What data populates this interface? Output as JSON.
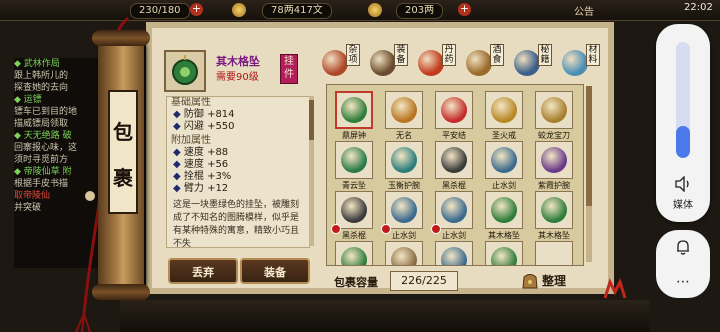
{
  "topbar": {
    "stamina": "230/180",
    "silver": "78两417文",
    "gold": "203两",
    "announce": "公告",
    "time": "22:02"
  },
  "quests": [
    {
      "t": "◆ 武林作局",
      "c": "h"
    },
    {
      "t": "跟上韩所儿的",
      "c": ""
    },
    {
      "t": "探查她的去向",
      "c": ""
    },
    {
      "t": "◆ 运镖",
      "c": "h"
    },
    {
      "t": "镖车已到目的地",
      "c": ""
    },
    {
      "t": "描威镖局领取",
      "c": ""
    },
    {
      "t": "◆ 天无绝路 破",
      "c": "h"
    },
    {
      "t": "回寨报心味，这",
      "c": ""
    },
    {
      "t": "须时寻觅前方",
      "c": ""
    },
    {
      "t": "◆ 帝陵仙草 附",
      "c": "h"
    },
    {
      "t": "根据手皮书描",
      "c": ""
    },
    {
      "t": "取帝陵仙",
      "c": "r"
    },
    {
      "t": "并突破",
      "c": ""
    }
  ],
  "scroll": {
    "label_top": "包",
    "label_bottom": "裹"
  },
  "item": {
    "name": "其木格坠",
    "requirement": "需要90级",
    "equip_label": "挂件",
    "base_title": "基础属性",
    "base_stats": [
      {
        "name": "防御",
        "value": "+814"
      },
      {
        "name": "闪避",
        "value": "+550"
      }
    ],
    "extra_title": "附加属性",
    "extra_stats": [
      {
        "name": "速度",
        "value": "+88"
      },
      {
        "name": "速度",
        "value": "+56"
      },
      {
        "name": "拴棍",
        "value": "+3%"
      },
      {
        "name": "臂力",
        "value": "+12"
      }
    ],
    "description": "这是一块墨绿色的挂坠，被雕刻成了不知名的图腾模样，似乎是有某种特殊的寓意，精致小巧且不失"
  },
  "buttons": {
    "discard": "丢弃",
    "equip": "装备",
    "sort": "整理"
  },
  "tabs": [
    {
      "label": "杂项",
      "color": "#b0472a"
    },
    {
      "label": "装备",
      "color": "#6a4c2e"
    },
    {
      "label": "丹药",
      "color": "#c23b1e"
    },
    {
      "label": "酒食",
      "color": "#9a6a2a"
    },
    {
      "label": "秘籍",
      "color": "#3b5f8a"
    },
    {
      "label": "材料",
      "color": "#4c8fb5"
    }
  ],
  "grid_items": [
    {
      "name": "鼎屏钟",
      "color": "#2f7d3a",
      "selected": true,
      "dot": false
    },
    {
      "name": "无名",
      "color": "#b8741f",
      "selected": false,
      "dot": false
    },
    {
      "name": "平安结",
      "color": "#c42b2b",
      "selected": false,
      "dot": false
    },
    {
      "name": "圣火戒",
      "color": "#b88726",
      "selected": false,
      "dot": false
    },
    {
      "name": "蛟龙宝刀",
      "color": "#a87f2e",
      "selected": false,
      "dot": false
    },
    {
      "name": "青云坠",
      "color": "#2b7a4a",
      "selected": false,
      "dot": false
    },
    {
      "name": "玉衡护腕",
      "color": "#2c7d7a",
      "selected": false,
      "dot": false
    },
    {
      "name": "黑杀棍",
      "color": "#3a3a3a",
      "selected": false,
      "dot": false
    },
    {
      "name": "止水剑",
      "color": "#3c6a8e",
      "selected": false,
      "dot": false
    },
    {
      "name": "紫霞护腕",
      "color": "#6a3a8a",
      "selected": false,
      "dot": false
    },
    {
      "name": "黑杀棍",
      "color": "#3a3a3a",
      "selected": false,
      "dot": true
    },
    {
      "name": "止水剑",
      "color": "#3c6a8e",
      "selected": false,
      "dot": true
    },
    {
      "name": "止水剑",
      "color": "#3c6a8e",
      "selected": false,
      "dot": true
    },
    {
      "name": "其木格坠",
      "color": "#2f7d3a",
      "selected": false,
      "dot": false
    },
    {
      "name": "其木格坠",
      "color": "#2f7d3a",
      "selected": false,
      "dot": false
    },
    {
      "name": "",
      "color": "#2f7d3a",
      "selected": false,
      "dot": true
    },
    {
      "name": "",
      "color": "#8a6b42",
      "selected": false,
      "dot": false
    },
    {
      "name": "",
      "color": "#3c6a8e",
      "selected": false,
      "dot": true
    },
    {
      "name": "",
      "color": "#2f7d3a",
      "selected": false,
      "dot": false
    },
    {
      "name": "",
      "color": "",
      "selected": false,
      "dot": false
    }
  ],
  "capacity": {
    "label": "包裹容量",
    "value": "226/225"
  },
  "volume": {
    "level": 0.28,
    "media_label": "媒体"
  }
}
